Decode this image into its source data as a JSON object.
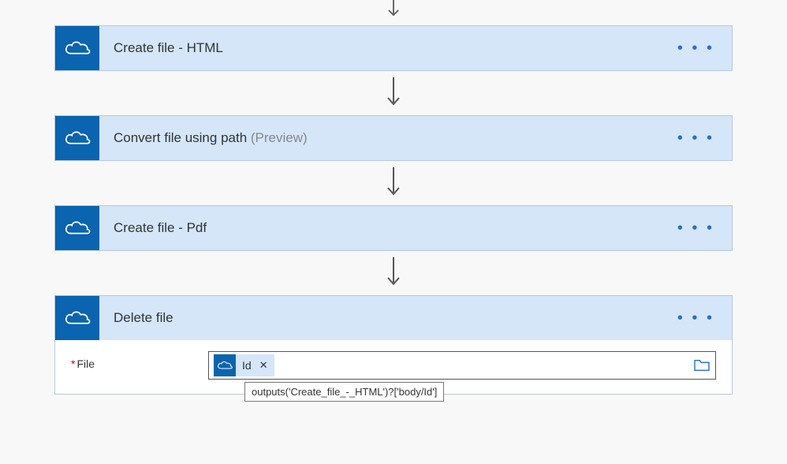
{
  "actions": [
    {
      "title": "Create file - HTML",
      "preview": ""
    },
    {
      "title": "Convert file using path",
      "preview": "(Preview)"
    },
    {
      "title": "Create file - Pdf",
      "preview": ""
    },
    {
      "title": "Delete file",
      "preview": ""
    }
  ],
  "deleteAction": {
    "fieldLabel": "File",
    "chipLabel": "Id",
    "tooltip": "outputs('Create_file_-_HTML')?['body/Id']"
  },
  "menu": "• • •",
  "closeGlyph": "✕"
}
